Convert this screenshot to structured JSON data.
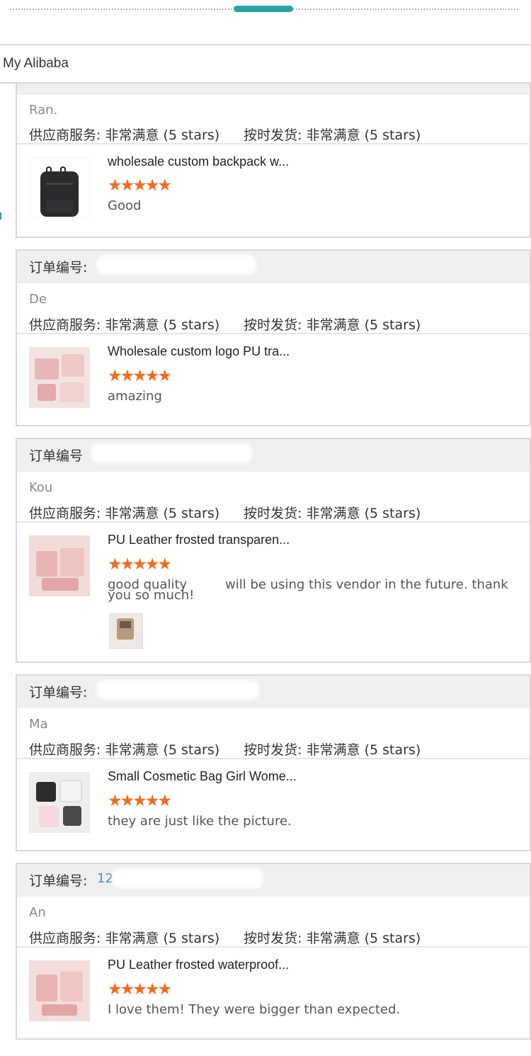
{
  "header": {
    "title": "My Alibaba"
  },
  "labels": {
    "order_number": "订单编号:",
    "order_number_nocolon": "订单编号",
    "supplier_service": "供应商服务: 非常满意 (5 stars)",
    "on_time": "按时发货: 非常满意 (5 stars)",
    "stars": "★★★★★"
  },
  "reviews": [
    {
      "buyer": "Ran.",
      "product": "wholesale custom backpack w...",
      "comment": "Good"
    },
    {
      "order_label": "订单编号:",
      "buyer": "De",
      "product": "Wholesale custom logo PU tra...",
      "comment": "amazing"
    },
    {
      "order_label": "订单编号",
      "buyer": "Kou",
      "product": "PU Leather frosted transparen...",
      "comment_a": "good quality",
      "comment_b": "will be using this vendor in the future. thank",
      "comment_c": "you so much!"
    },
    {
      "order_label": "订单编号:",
      "buyer": "Ma",
      "product": "Small Cosmetic Bag Girl Wome...",
      "comment": "they are just like the picture."
    },
    {
      "order_label": "订单编号:",
      "order_value": "12",
      "buyer": "An",
      "product": "PU Leather frosted waterproof...",
      "comment": "I love them! They were bigger than expected."
    }
  ],
  "colors": {
    "accent": "#2aa2a6",
    "star": "#f26b1d",
    "link": "#4a90c2"
  }
}
